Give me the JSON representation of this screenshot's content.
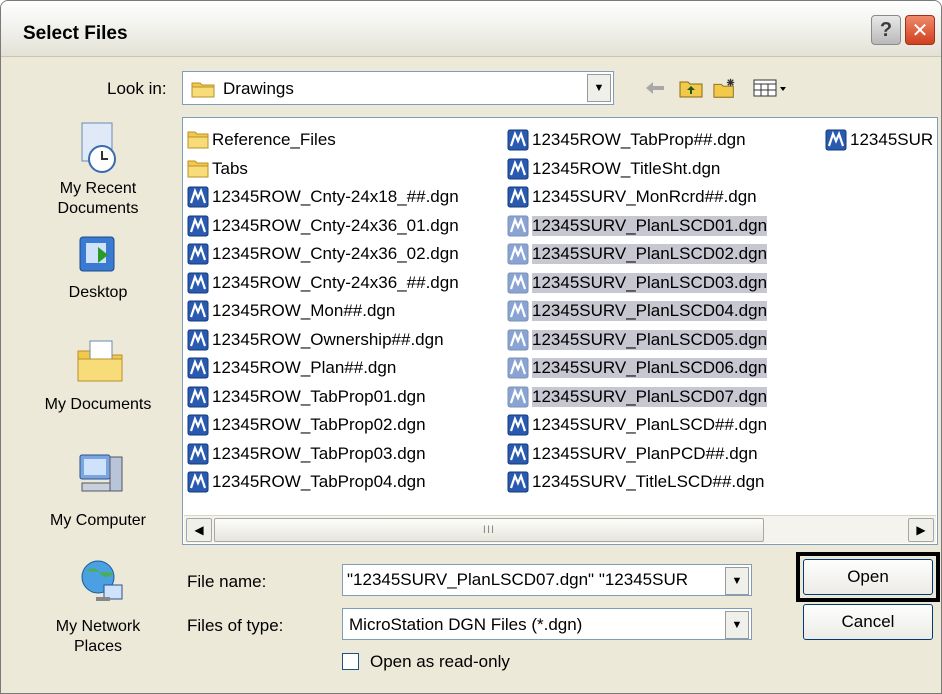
{
  "window": {
    "title": "Select Files"
  },
  "titlebar": {
    "help_label": "?",
    "close_label": "✕"
  },
  "lookin": {
    "label": "Look in:",
    "value": "Drawings"
  },
  "toolbar": {
    "icons": [
      "back-arrow-icon",
      "up-folder-icon",
      "new-folder-icon",
      "view-menu-icon"
    ]
  },
  "places": [
    {
      "label": "My Recent Documents",
      "icon": "recent-documents-icon"
    },
    {
      "label": "Desktop",
      "icon": "desktop-icon"
    },
    {
      "label": "My Documents",
      "icon": "my-documents-icon"
    },
    {
      "label": "My Computer",
      "icon": "my-computer-icon"
    },
    {
      "label": "My Network Places",
      "icon": "network-places-icon"
    }
  ],
  "files": {
    "col1": [
      {
        "name": "Reference_Files",
        "type": "folder"
      },
      {
        "name": "Tabs",
        "type": "folder"
      },
      {
        "name": "12345ROW_Cnty-24x18_##.dgn",
        "type": "dgn"
      },
      {
        "name": "12345ROW_Cnty-24x36_01.dgn",
        "type": "dgn"
      },
      {
        "name": "12345ROW_Cnty-24x36_02.dgn",
        "type": "dgn"
      },
      {
        "name": "12345ROW_Cnty-24x36_##.dgn",
        "type": "dgn"
      },
      {
        "name": "12345ROW_Mon##.dgn",
        "type": "dgn"
      },
      {
        "name": "12345ROW_Ownership##.dgn",
        "type": "dgn"
      },
      {
        "name": "12345ROW_Plan##.dgn",
        "type": "dgn"
      },
      {
        "name": "12345ROW_TabProp01.dgn",
        "type": "dgn"
      },
      {
        "name": "12345ROW_TabProp02.dgn",
        "type": "dgn"
      },
      {
        "name": "12345ROW_TabProp03.dgn",
        "type": "dgn"
      },
      {
        "name": "12345ROW_TabProp04.dgn",
        "type": "dgn"
      }
    ],
    "col2": [
      {
        "name": "12345ROW_TabProp##.dgn",
        "type": "dgn"
      },
      {
        "name": "12345ROW_TitleSht.dgn",
        "type": "dgn"
      },
      {
        "name": "12345SURV_MonRcrd##.dgn",
        "type": "dgn"
      },
      {
        "name": "12345SURV_PlanLSCD01.dgn",
        "type": "dgn",
        "selected": true
      },
      {
        "name": "12345SURV_PlanLSCD02.dgn",
        "type": "dgn",
        "selected": true
      },
      {
        "name": "12345SURV_PlanLSCD03.dgn",
        "type": "dgn",
        "selected": true
      },
      {
        "name": "12345SURV_PlanLSCD04.dgn",
        "type": "dgn",
        "selected": true
      },
      {
        "name": "12345SURV_PlanLSCD05.dgn",
        "type": "dgn",
        "selected": true
      },
      {
        "name": "12345SURV_PlanLSCD06.dgn",
        "type": "dgn",
        "selected": true
      },
      {
        "name": "12345SURV_PlanLSCD07.dgn",
        "type": "dgn",
        "selected": true
      },
      {
        "name": "12345SURV_PlanLSCD##.dgn",
        "type": "dgn"
      },
      {
        "name": "12345SURV_PlanPCD##.dgn",
        "type": "dgn"
      },
      {
        "name": "12345SURV_TitleLSCD##.dgn",
        "type": "dgn"
      }
    ],
    "col3": [
      {
        "name": "12345SUR",
        "type": "dgn"
      }
    ]
  },
  "scrollbar": {
    "grip": "III"
  },
  "filename": {
    "label": "File name:",
    "value": "\"12345SURV_PlanLSCD07.dgn\" \"12345SUR"
  },
  "filetype": {
    "label": "Files of type:",
    "value": "MicroStation DGN Files (*.dgn)"
  },
  "readonly": {
    "label": "Open as read-only"
  },
  "buttons": {
    "open": "Open",
    "cancel": "Cancel"
  }
}
